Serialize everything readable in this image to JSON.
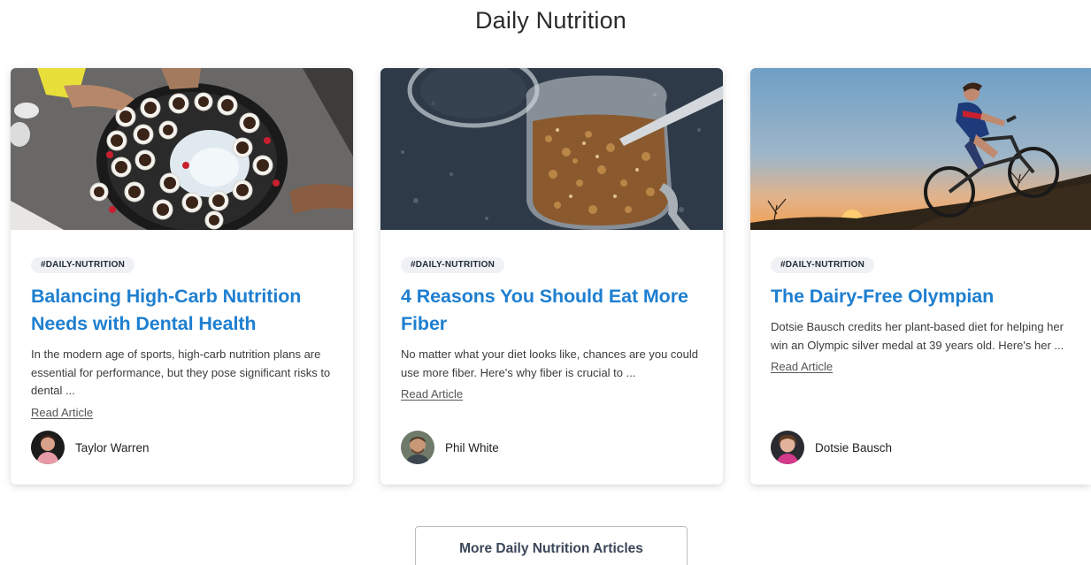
{
  "section": {
    "title": "Daily Nutrition"
  },
  "cards": [
    {
      "image_icon": "ice-bucket-cups-photo",
      "tag": "#DAILY-NUTRITION",
      "title": "Balancing High-Carb Nutrition Needs with Dental Health",
      "excerpt": "In the modern age of sports, high-carb nutrition plans are essential for performance, but they pose significant risks to dental ...",
      "link_label": "Read Article",
      "author": "Taylor Warren"
    },
    {
      "image_icon": "granola-jar-photo",
      "tag": "#DAILY-NUTRITION",
      "title": "4 Reasons You Should Eat More Fiber",
      "excerpt": "No matter what your diet looks like, chances are you could use more fiber. Here's why fiber is crucial to ...",
      "link_label": "Read Article",
      "author": "Phil White"
    },
    {
      "image_icon": "cyclist-sunset-photo",
      "tag": "#DAILY-NUTRITION",
      "title": "The Dairy-Free Olympian",
      "excerpt": "Dotsie Bausch credits her plant-based diet for helping her win an Olympic silver medal at 39 years old. Here's her ...",
      "link_label": "Read Article",
      "author": "Dotsie Bausch"
    }
  ],
  "footer": {
    "more_button_label": "More Daily Nutrition Articles"
  },
  "colors": {
    "title_link": "#1e7fd0",
    "tag_bg": "#eff1f4",
    "button_text": "#3a4658"
  }
}
